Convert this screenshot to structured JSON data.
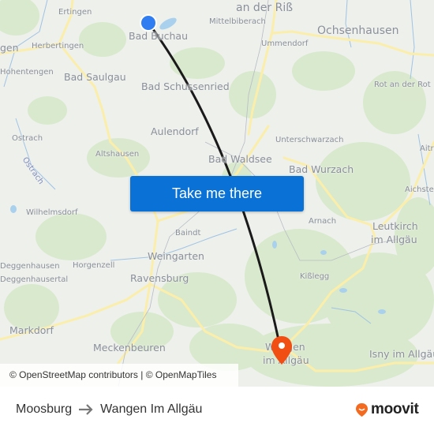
{
  "map": {
    "colors": {
      "land": "#eef0ec",
      "forest": "#d6e8c8",
      "water": "#a9d0ec",
      "road": "#fbeeaa",
      "route_line": "#1a1a1a",
      "origin_marker": "#2f7df0",
      "destination_marker": "#f04e13"
    },
    "places": [
      {
        "id": "ertingen",
        "label": "Ertingen",
        "size": "sm"
      },
      {
        "id": "bad-buchau",
        "label": "Bad Buchau",
        "size": "md"
      },
      {
        "id": "biberach",
        "label": "an der Riß",
        "size": "lg"
      },
      {
        "id": "mittelbiberach",
        "label": "Mittelbiberach",
        "size": "sm"
      },
      {
        "id": "ochsenhausen",
        "label": "Ochsenhausen",
        "size": "lg"
      },
      {
        "id": "herbertingen",
        "label": "Herbertingen",
        "size": "sm"
      },
      {
        "id": "mengen",
        "label": "gen",
        "size": "md"
      },
      {
        "id": "ummendorf",
        "label": "Ummendorf",
        "size": "sm"
      },
      {
        "id": "hohentengen",
        "label": "Hohentengen",
        "size": "sm"
      },
      {
        "id": "bad-saulgau",
        "label": "Bad Saulgau",
        "size": "md"
      },
      {
        "id": "bad-schussenried",
        "label": "Bad Schussenried",
        "size": "md"
      },
      {
        "id": "rot-an-der-rot",
        "label": "Rot an der Rot",
        "size": "sm"
      },
      {
        "id": "aulendorf",
        "label": "Aulendorf",
        "size": "md"
      },
      {
        "id": "ostrach",
        "label": "Ostrach",
        "size": "sm"
      },
      {
        "id": "unterschwarzach",
        "label": "Unterschwarzach",
        "size": "sm"
      },
      {
        "id": "altshausen",
        "label": "Altshausen",
        "size": "sm"
      },
      {
        "id": "aitrach",
        "label": "Aitra",
        "size": "sm"
      },
      {
        "id": "bad-waldsee",
        "label": "Bad Waldsee",
        "size": "md"
      },
      {
        "id": "bad-wurzach",
        "label": "Bad Wurzach",
        "size": "md"
      },
      {
        "id": "aichstetten",
        "label": "Aichstet",
        "size": "sm"
      },
      {
        "id": "wilhelmsdorf",
        "label": "Wilhelmsdorf",
        "size": "sm"
      },
      {
        "id": "arnach",
        "label": "Arnach",
        "size": "sm"
      },
      {
        "id": "baindt",
        "label": "Baindt",
        "size": "sm"
      },
      {
        "id": "leutkirch-1",
        "label": "Leutkirch",
        "size": "md"
      },
      {
        "id": "leutkirch-2",
        "label": "im Allgäu",
        "size": "md"
      },
      {
        "id": "weingarten",
        "label": "Weingarten",
        "size": "md"
      },
      {
        "id": "deggenhausen",
        "label": "Deggenhausen",
        "size": "sm"
      },
      {
        "id": "horgenzell",
        "label": "Horgenzell",
        "size": "sm"
      },
      {
        "id": "kisslegg",
        "label": "Kißlegg",
        "size": "sm"
      },
      {
        "id": "deggenhausertal",
        "label": "Deggenhausertal",
        "size": "sm"
      },
      {
        "id": "ravensburg",
        "label": "Ravensburg",
        "size": "md"
      },
      {
        "id": "markdorf",
        "label": "Markdorf",
        "size": "md"
      },
      {
        "id": "meckenbeuren",
        "label": "Meckenbeuren",
        "size": "md"
      },
      {
        "id": "wangen-1",
        "label": "Wangen",
        "size": "md"
      },
      {
        "id": "wangen-2",
        "label": "im Allgäu",
        "size": "md"
      },
      {
        "id": "isny",
        "label": "Isny im Allgäu",
        "size": "md"
      }
    ],
    "river_label": "Ostrach",
    "cta_label": "Take me there",
    "attribution": {
      "osm": "© OpenStreetMap contributors",
      "separator": " | ",
      "omt": "© OpenMapTiles"
    }
  },
  "footer": {
    "origin": "Moosburg",
    "destination": "Wangen Im Allgäu",
    "brand": "moovit",
    "brand_color": "#f26b21"
  }
}
